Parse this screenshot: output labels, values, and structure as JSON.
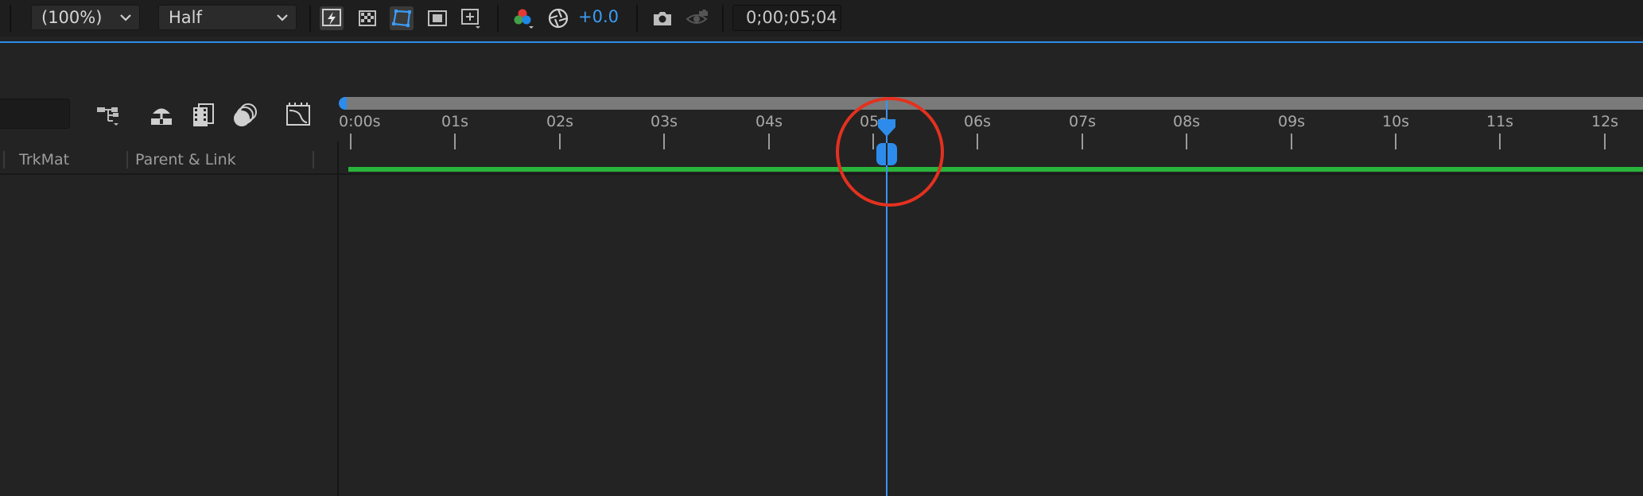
{
  "toolbar": {
    "zoom_value": "(100%)",
    "resolution_value": "Half",
    "exposure_value": "+0.0",
    "timecode": "0;00;05;04",
    "icons": [
      "fast-previews-icon",
      "transparency-grid-icon",
      "mask-path-visibility-icon",
      "region-of-interest-icon",
      "safe-margins-icon",
      "channel-rgb-icon",
      "exposure-reset-icon",
      "snapshot-camera-icon",
      "show-snapshot-icon"
    ],
    "accent_color": "#2d8ceb"
  },
  "timeline": {
    "columns": [
      "TrkMat",
      "Parent & Link"
    ],
    "icons": [
      "composition-flowchart-icon",
      "draft-3d-icon",
      "frame-blending-icon",
      "motion-blur-icon",
      "graph-editor-icon"
    ],
    "ruler_labels": [
      "0:00s",
      "01s",
      "02s",
      "03s",
      "04s",
      "05s",
      "06s",
      "07s",
      "08s",
      "09s",
      "10s",
      "11s",
      "12s"
    ],
    "current_time_label": "05s",
    "work_area_color": "#29b43b",
    "highlight_color": "#e4311f"
  }
}
